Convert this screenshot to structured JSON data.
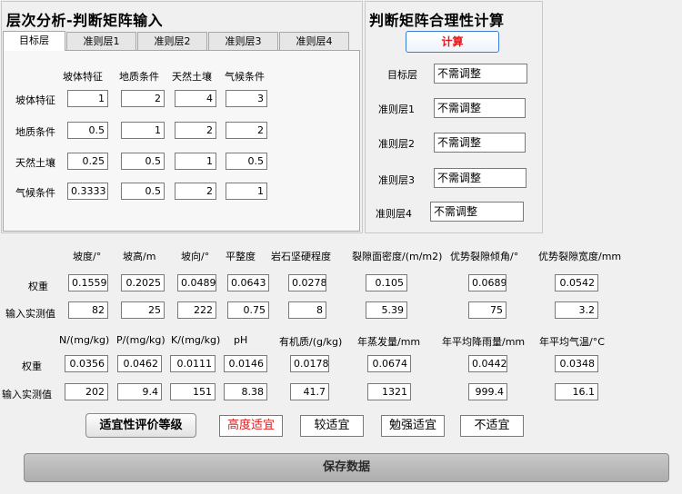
{
  "left_panel": {
    "title": "层次分析-判断矩阵输入",
    "tabs": [
      "目标层",
      "准则层1",
      "准则层2",
      "准则层3",
      "准则层4"
    ],
    "col_headers": [
      "坡体特征",
      "地质条件",
      "天然土壤",
      "气候条件"
    ],
    "row_headers": [
      "坡体特征",
      "地质条件",
      "天然土壤",
      "气候条件"
    ],
    "matrix": [
      [
        "1",
        "2",
        "4",
        "3"
      ],
      [
        "0.5",
        "1",
        "2",
        "2"
      ],
      [
        "0.25",
        "0.5",
        "1",
        "0.5"
      ],
      [
        "0.3333",
        "0.5",
        "2",
        "1"
      ]
    ]
  },
  "right_panel": {
    "title": "判断矩阵合理性计算",
    "calc_label": "计算",
    "accent_color": "#e01b1b",
    "rows": [
      {
        "label": "目标层",
        "value": "不需调整"
      },
      {
        "label": "准则层1",
        "value": "不需调整"
      },
      {
        "label": "准则层2",
        "value": "不需调整"
      },
      {
        "label": "准则层3",
        "value": "不需调整"
      },
      {
        "label": "准则层4",
        "value": "不需调整"
      }
    ]
  },
  "section1": {
    "headers": [
      "坡度/°",
      "坡高/m",
      "坡向/°",
      "平整度",
      "岩石坚硬程度",
      "裂隙面密度/(m/m2)",
      "优势裂隙倾角/°",
      "优势裂隙宽度/mm"
    ],
    "weight_label": "权重",
    "measure_label": "输入实测值",
    "weights": [
      "0.1559",
      "0.2025",
      "0.0489",
      "0.0643",
      "0.0278",
      "0.105",
      "0.0689",
      "0.0542"
    ],
    "measures": [
      "82",
      "25",
      "222",
      "0.75",
      "8",
      "5.39",
      "75",
      "3.2"
    ]
  },
  "section2": {
    "headers": [
      "N/(mg/kg)",
      "P/(mg/kg)",
      "K/(mg/kg)",
      "pH",
      "有机质/(g/kg)",
      "年蒸发量/mm",
      "年平均降雨量/mm",
      "年平均气温/°C"
    ],
    "weight_label": "权重",
    "measure_label": "输入实测值",
    "weights": [
      "0.0356",
      "0.0462",
      "0.0111",
      "0.0146",
      "0.0178",
      "0.0674",
      "0.0442",
      "0.0348"
    ],
    "measures": [
      "202",
      "9.4",
      "151",
      "8.38",
      "41.7",
      "1321",
      "999.4",
      "16.1"
    ]
  },
  "evaluation": {
    "button_label": "适宜性评价等级",
    "levels": [
      "高度适宜",
      "较适宜",
      "勉强适宜",
      "不适宜"
    ],
    "highlight_color": "#e01b1b"
  },
  "save_label": "保存数据"
}
